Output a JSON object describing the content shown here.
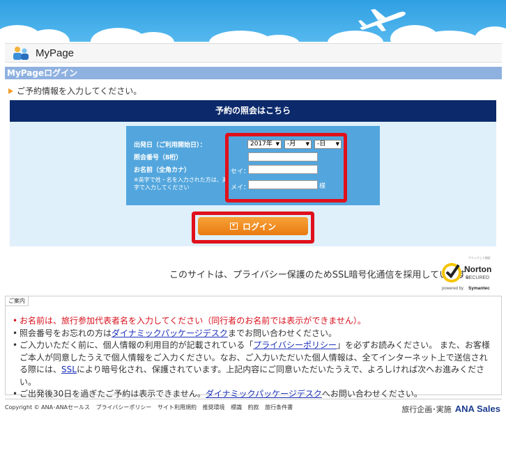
{
  "header": {
    "page_title": "MyPage"
  },
  "section": {
    "title": "MyPageログイン"
  },
  "intro": {
    "text": "ご予約情報を入力してください。"
  },
  "form": {
    "heading": "予約の照会はこちら",
    "departure_label": "出発日（ご利用開始日）：",
    "year_value": "2017年",
    "month_value": "-月",
    "day_value": "-日",
    "reference_label": "照会番号（8桁）",
    "name_label": "お名前（全角カナ）",
    "note": "※英字で姓・名を入力された方は、英字で入力してください",
    "sei_label": "セイ：",
    "mei_label": "メイ：",
    "sama_suffix": "様",
    "reference_value": "",
    "sei_value": "",
    "mei_value": ""
  },
  "login_button": {
    "label": "ログイン"
  },
  "ssl": {
    "text": "このサイトは、プライバシー保護のためSSL暗号化通信を採用しています。"
  },
  "norton": {
    "click_text": "クリックして検証",
    "brand": "Norton",
    "secured": "SECURED",
    "powered": "powered by",
    "symantec": "Symantec"
  },
  "guide": {
    "tab": "ご案内",
    "items": [
      {
        "text": "お名前は、旅行参加代表者名を入力してください（同行者のお名前では表示ができません）。"
      },
      {
        "pre": "照会番号をお忘れの方は",
        "link": "ダイナミックパッケージデスク",
        "post": "までお問い合わせください。"
      },
      {
        "pre": "ご入力いただく前に、個人情報の利用目的が記載されている「",
        "link": "プライバシーポリシー",
        "mid": "」を必ずお読みください。 また、お客様ご本人が同意したうえで個人情報をご入力ください。なお、ご入力いただいた個人情報は、全てインターネット上で送信される際には、",
        "link2": "SSL",
        "post": "により暗号化され、保護されています。上記内容にご同意いただいたうえで、よろしければ次へお進みください。"
      },
      {
        "pre": "ご出発後30日を過ぎたご予約は表示できません。",
        "link": "ダイナミックパッケージデスク",
        "post": "へお問い合わせください。"
      }
    ]
  },
  "footer": {
    "copyright": "Copyright © ANA･ANAセールス",
    "links": [
      "プライバシーポリシー",
      "サイト利用規約",
      "推奨環境",
      "標識",
      "約款",
      "旅行条件書"
    ],
    "organizer": "旅行企画･実施",
    "brand": "ANA Sales"
  },
  "colors": {
    "accent_red": "#e0101b",
    "navy": "#0c2a6b",
    "form_blue": "#53a6dd",
    "button_orange": "#f39a1f"
  }
}
